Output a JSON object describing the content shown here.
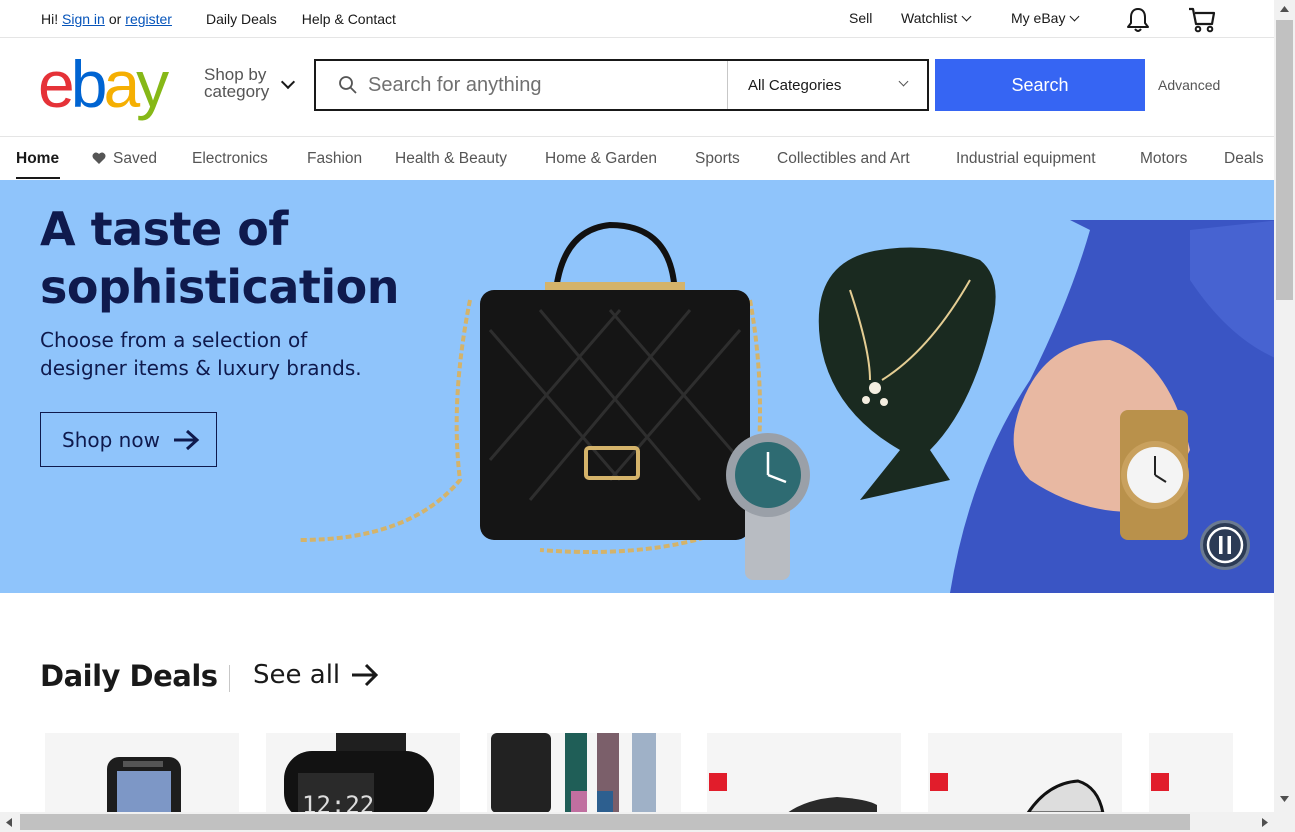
{
  "topbar": {
    "greeting": "Hi!",
    "sign_in": "Sign in",
    "or": "or",
    "register": "register",
    "daily_deals": "Daily Deals",
    "help_contact": "Help & Contact",
    "sell": "Sell",
    "watchlist": "Watchlist",
    "my_ebay": "My eBay"
  },
  "header": {
    "logo": "ebay",
    "shop_by_line1": "Shop by",
    "shop_by_line2": "category",
    "search_placeholder": "Search for anything",
    "category": "All Categories",
    "search_button": "Search",
    "advanced": "Advanced"
  },
  "nav": {
    "items": [
      "Home",
      "Saved",
      "Electronics",
      "Fashion",
      "Health & Beauty",
      "Home & Garden",
      "Sports",
      "Collectibles and Art",
      "Industrial equipment",
      "Motors",
      "Deals"
    ]
  },
  "hero": {
    "title": "A taste of sophistication",
    "subtitle": "Choose from a selection of designer items & luxury brands.",
    "cta": "Shop now"
  },
  "daily_deals": {
    "title": "Daily Deals",
    "see_all": "See all"
  },
  "icons": {
    "search": "search-icon",
    "bell": "bell-icon",
    "cart": "cart-icon",
    "heart": "heart-icon",
    "pause": "pause-icon",
    "arrow": "arrow-right-icon"
  },
  "colors": {
    "accent": "#3665f3",
    "hero_bg": "#8fc4fb",
    "hero_text": "#0f1a4d",
    "link": "#0654ba"
  }
}
